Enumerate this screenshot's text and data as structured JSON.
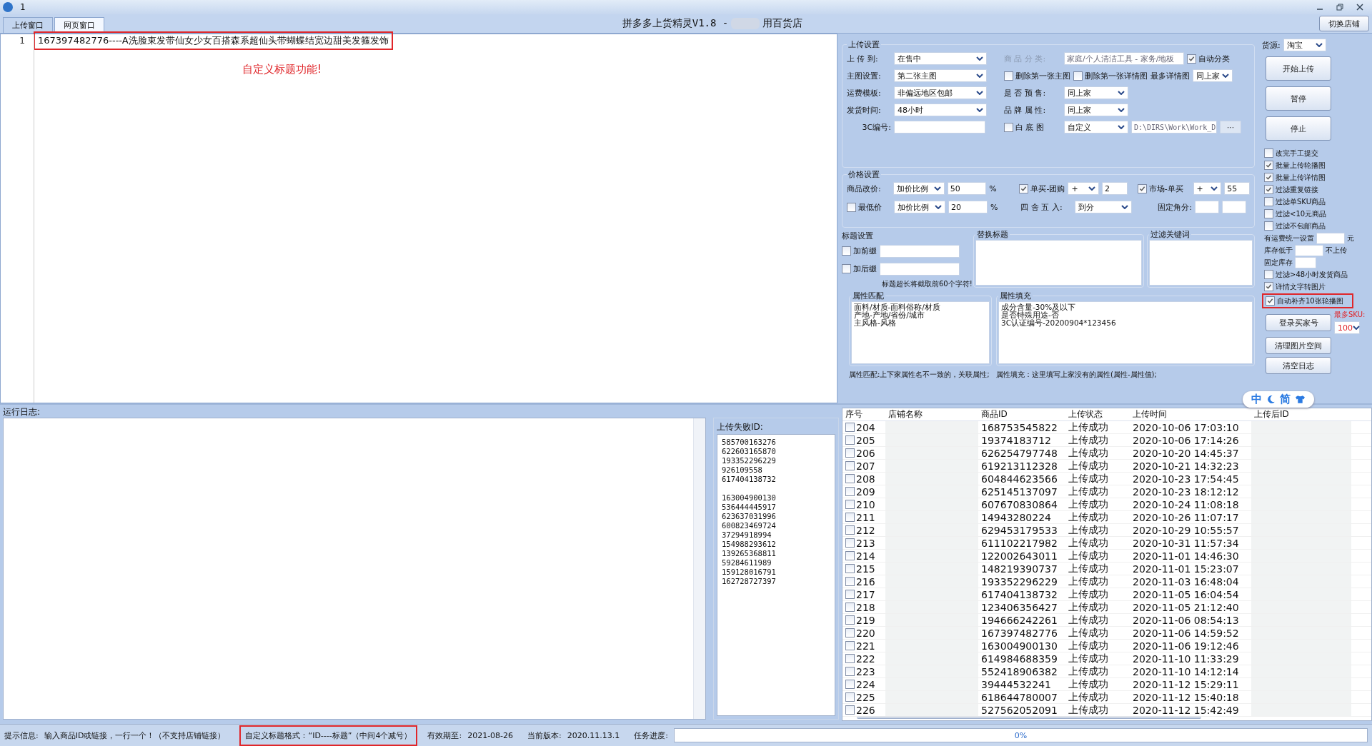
{
  "window": {
    "number": "1",
    "title": "拼多多上货精灵V1.8 -",
    "title_end": "用百货店"
  },
  "tabs": [
    {
      "label": "上传窗口",
      "selected": false
    },
    {
      "label": "网页窗口",
      "selected": true
    }
  ],
  "switch_store_button": "切换店铺",
  "editor": {
    "lines": [
      {
        "number": "1",
        "text": "167397482776----A洗脸束发带仙女少女百搭森系超仙头带蝴蝶结宽边甜美发箍发饰",
        "highlighted": true
      }
    ],
    "annotation": "自定义标题功能!"
  },
  "upload_settings": {
    "title": "上传设置",
    "fields": [
      {
        "label": "上 传 到:",
        "value": "在售中"
      },
      {
        "label": "主图设置:",
        "value": "第二张主图"
      },
      {
        "label": "运费模板:",
        "value": "非偏远地区包邮"
      },
      {
        "label": "发货时间:",
        "value": "48小时"
      }
    ],
    "cc_code": {
      "label": "3C编号:"
    },
    "category": {
      "label": "商 品 分 类:",
      "value": "家庭/个人清洁工具 - 家务/地板",
      "disabled": true
    },
    "auto_category": {
      "label": "自动分类",
      "checked": true
    },
    "delete_first_main": {
      "label": "删除第一张主图",
      "checked": false
    },
    "delete_first_detail": {
      "label": "删除第一张详情图",
      "checked": false
    },
    "max_detail": {
      "label": "最多详情图",
      "value": "同上家"
    },
    "presale": {
      "label": "是 否 预 售:",
      "value": "同上家"
    },
    "brand": {
      "label": "品 牌 属 性:",
      "value": "同上家"
    },
    "white_bg": {
      "label": "白 底 图",
      "checked": false,
      "value": "自定义",
      "path": "D:\\DIRS\\Work\\Work_D",
      "browse": "···"
    }
  },
  "price_settings": {
    "title": "价格设置",
    "reprice": {
      "label": "商品改价:",
      "mode": "加价比例",
      "value": "50",
      "unit": "%"
    },
    "min_price": {
      "label": "最低价",
      "checked": false,
      "mode": "加价比例",
      "value": "20",
      "unit": "%"
    },
    "single_group": {
      "label": "单买-团购",
      "checked": true,
      "op": "+",
      "value": "2"
    },
    "market_single": {
      "label": "市场-单买",
      "checked": true,
      "op": "+",
      "value": "55"
    },
    "rounding": {
      "label": "四 舍 五 入:",
      "value": "到分"
    },
    "fixed_cents": {
      "label": "固定角分:"
    }
  },
  "title_settings": {
    "title": "标题设置",
    "prefix": {
      "label": "加前缀",
      "checked": false
    },
    "suffix": {
      "label": "加后缀",
      "checked": false
    },
    "note": "标题超长将截取前60个字符!",
    "replace_title": {
      "title": "替换标题"
    },
    "filter_keywords": {
      "title": "过滤关键词"
    }
  },
  "attributes": {
    "match": {
      "title": "属性匹配",
      "lines": [
        "面料/材质-面料俗称/材质",
        "产地-产地/省份/城市",
        "主风格-风格"
      ],
      "note": "属性匹配:上下家属性名不一致的，关联属性;"
    },
    "fill": {
      "title": "属性填充",
      "lines": [
        "成分含量-30%及以下",
        "是否特殊用途-否",
        "3C认证编号-20200904*123456"
      ],
      "note": "属性填充：这里填写上家没有的属性(属性-属性值);"
    }
  },
  "controls": {
    "source": {
      "label": "货源:",
      "value": "淘宝"
    },
    "buttons": [
      "开始上传",
      "暂停",
      "停止"
    ],
    "options": [
      {
        "kind": "checkbox",
        "label": "改完手工提交",
        "checked": false,
        "highlighted": false
      },
      {
        "kind": "checkbox",
        "label": "批量上传轮播图",
        "checked": true,
        "highlighted": false
      },
      {
        "kind": "checkbox",
        "label": "批量上传详情图",
        "checked": true,
        "highlighted": false
      },
      {
        "kind": "checkbox",
        "label": "过滤重复链接",
        "checked": true,
        "highlighted": false
      },
      {
        "kind": "checkbox",
        "label": "过滤单SKU商品",
        "checked": false,
        "highlighted": false
      },
      {
        "kind": "checkbox",
        "label": "过滤<10元商品",
        "checked": false,
        "highlighted": false
      },
      {
        "kind": "checkbox",
        "label": "过滤不包邮商品",
        "checked": false,
        "highlighted": false
      },
      {
        "kind": "input",
        "label": "有运费统一设置",
        "unit": "元"
      },
      {
        "kind": "input",
        "label": "库存低于",
        "unit": "不上传"
      },
      {
        "kind": "input",
        "label": "固定库存"
      },
      {
        "kind": "checkbox",
        "label": "过滤>48小时发货商品",
        "checked": false,
        "highlighted": false
      },
      {
        "kind": "checkbox",
        "label": "详情文字转图片",
        "checked": true,
        "highlighted": false
      },
      {
        "kind": "checkbox",
        "label": "自动补齐10张轮播图",
        "checked": true,
        "highlighted": true
      }
    ],
    "login_button": "登录买家号",
    "max_sku": {
      "label": "最多SKU:",
      "value": "100"
    },
    "more_buttons": [
      "清理图片空间",
      "清空日志"
    ]
  },
  "log": {
    "label": "运行日志:"
  },
  "failed": {
    "title": "上传失败ID:",
    "groups": [
      [
        "585700163276",
        "622603165870",
        "193352296229",
        "926109558",
        "617404138732"
      ],
      [
        "163004900130",
        "536444445917",
        "623637031996",
        "600823469724",
        "37294918994",
        "154988293612",
        "139265368811",
        "59284611989",
        "159128016791",
        "162728727397"
      ]
    ]
  },
  "table": {
    "columns": [
      "序号",
      "店铺名称",
      "商品ID",
      "上传状态",
      "上传时间",
      "上传后ID"
    ],
    "rows": [
      {
        "number": "204",
        "checked": false,
        "product_id": "168753545822",
        "status": "上传成功",
        "time": "2020-10-06 17:03:10"
      },
      {
        "number": "205",
        "checked": false,
        "product_id": "19374183712",
        "status": "上传成功",
        "time": "2020-10-06 17:14:26"
      },
      {
        "number": "206",
        "checked": false,
        "product_id": "626254797748",
        "status": "上传成功",
        "time": "2020-10-20 14:45:37"
      },
      {
        "number": "207",
        "checked": false,
        "product_id": "619213112328",
        "status": "上传成功",
        "time": "2020-10-21 14:32:23"
      },
      {
        "number": "208",
        "checked": false,
        "product_id": "604844623566",
        "status": "上传成功",
        "time": "2020-10-23 17:54:45"
      },
      {
        "number": "209",
        "checked": false,
        "product_id": "625145137097",
        "status": "上传成功",
        "time": "2020-10-23 18:12:12"
      },
      {
        "number": "210",
        "checked": false,
        "product_id": "607670830864",
        "status": "上传成功",
        "time": "2020-10-24 11:08:18"
      },
      {
        "number": "211",
        "checked": false,
        "product_id": "14943280224",
        "status": "上传成功",
        "time": "2020-10-26 11:07:17"
      },
      {
        "number": "212",
        "checked": false,
        "product_id": "629453179533",
        "status": "上传成功",
        "time": "2020-10-29 10:55:57"
      },
      {
        "number": "213",
        "checked": false,
        "product_id": "611102217982",
        "status": "上传成功",
        "time": "2020-10-31 11:57:34"
      },
      {
        "number": "214",
        "checked": false,
        "product_id": "122002643011",
        "status": "上传成功",
        "time": "2020-11-01 14:46:30"
      },
      {
        "number": "215",
        "checked": false,
        "product_id": "148219390737",
        "status": "上传成功",
        "time": "2020-11-01 15:23:07"
      },
      {
        "number": "216",
        "checked": false,
        "product_id": "193352296229",
        "status": "上传成功",
        "time": "2020-11-03 16:48:04"
      },
      {
        "number": "217",
        "checked": false,
        "product_id": "617404138732",
        "status": "上传成功",
        "time": "2020-11-05 16:04:54"
      },
      {
        "number": "218",
        "checked": false,
        "product_id": "123406356427",
        "status": "上传成功",
        "time": "2020-11-05 21:12:40"
      },
      {
        "number": "219",
        "checked": false,
        "product_id": "194666242261",
        "status": "上传成功",
        "time": "2020-11-06 08:54:13"
      },
      {
        "number": "220",
        "checked": false,
        "product_id": "167397482776",
        "status": "上传成功",
        "time": "2020-11-06 14:59:52"
      },
      {
        "number": "221",
        "checked": false,
        "product_id": "163004900130",
        "status": "上传成功",
        "time": "2020-11-06 19:12:46"
      },
      {
        "number": "222",
        "checked": false,
        "product_id": "614984688359",
        "status": "上传成功",
        "time": "2020-11-10 11:33:29"
      },
      {
        "number": "223",
        "checked": false,
        "product_id": "552418906382",
        "status": "上传成功",
        "time": "2020-11-10 14:12:14"
      },
      {
        "number": "224",
        "checked": false,
        "product_id": "39444532241",
        "status": "上传成功",
        "time": "2020-11-12 15:29:11"
      },
      {
        "number": "225",
        "checked": false,
        "product_id": "618644780007",
        "status": "上传成功",
        "time": "2020-11-12 15:40:18"
      },
      {
        "number": "226",
        "checked": false,
        "product_id": "527562052091",
        "status": "上传成功",
        "time": "2020-11-12 15:42:49"
      }
    ]
  },
  "ime": {
    "chinese": "中",
    "simplified": "简"
  },
  "status_bar": {
    "hint_label": "提示信息:",
    "hint": "输入商品ID或链接，一行一个！（不支持店铺链接）",
    "custom_format": "自定义标题格式：“ID----标题”（中间4个减号）",
    "custom_highlighted": true,
    "expiry_label": "有效期至:",
    "expiry": "2021-08-26",
    "version_label": "当前版本:",
    "version": "2020.11.13.1",
    "progress_label": "任务进度:",
    "progress": {
      "level": 0,
      "reading": "0%"
    }
  }
}
